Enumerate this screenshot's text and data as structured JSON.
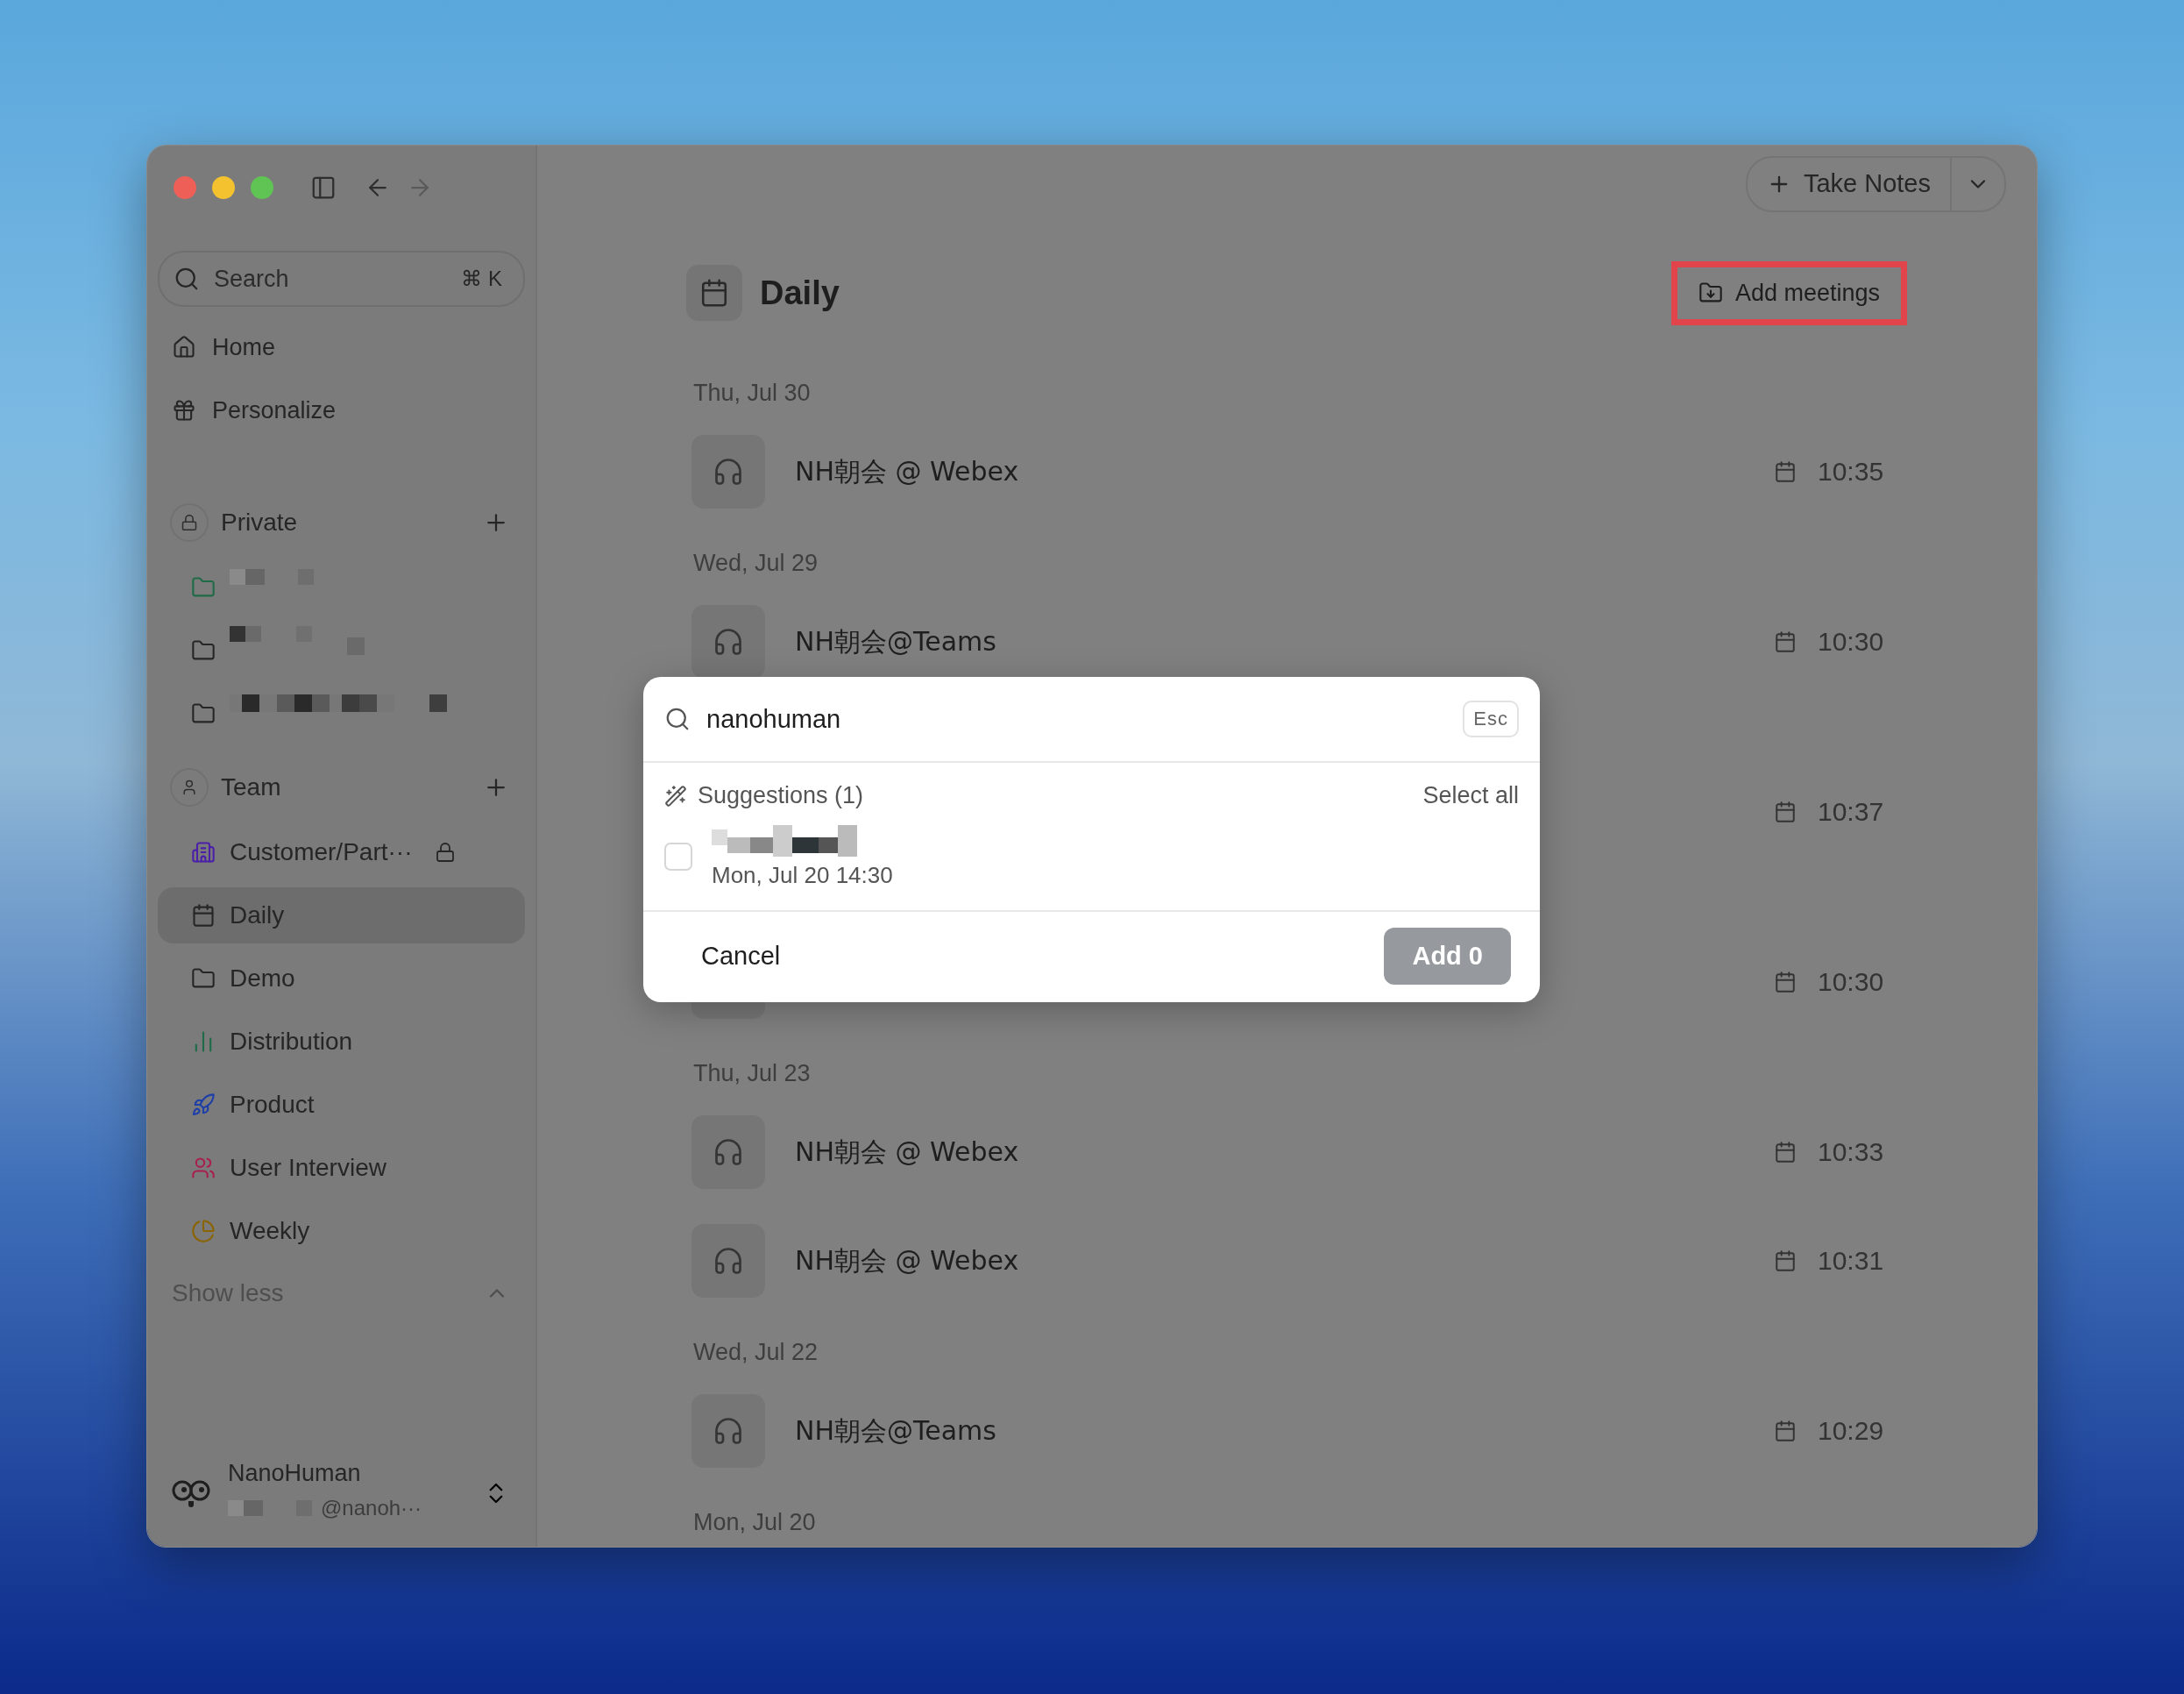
{
  "toolbar": {
    "take_notes": "Take Notes",
    "menu_caret": true
  },
  "sidebar": {
    "search": {
      "placeholder": "Search",
      "shortcut": "⌘ K"
    },
    "nav": [
      {
        "kind": "home",
        "label": "Home"
      },
      {
        "kind": "personalize",
        "label": "Personalize"
      }
    ],
    "sections": [
      {
        "kind": "private",
        "title": "Private",
        "items": [
          {
            "kind": "folder",
            "color": "#1f6b47"
          },
          {
            "kind": "folder",
            "color": "#262626"
          },
          {
            "kind": "folder",
            "color": "#262626"
          }
        ]
      },
      {
        "kind": "team",
        "title": "Team",
        "items": [
          {
            "kind": "building",
            "label": "Customer/Part···",
            "color": "#4b1fa8",
            "locked": true,
            "selected": false
          },
          {
            "kind": "calendar",
            "label": "Daily",
            "color": "#262626",
            "locked": false,
            "selected": true
          },
          {
            "kind": "folder",
            "label": "Demo",
            "color": "#262626",
            "locked": false,
            "selected": false
          },
          {
            "kind": "chart",
            "label": "Distribution",
            "color": "#1f6b47",
            "locked": false,
            "selected": false
          },
          {
            "kind": "rocket",
            "label": "Product",
            "color": "#1f3fa8",
            "locked": false,
            "selected": false
          },
          {
            "kind": "users",
            "label": "User Interview",
            "color": "#a81f4f",
            "locked": false,
            "selected": false
          },
          {
            "kind": "pie",
            "label": "Weekly",
            "color": "#8a6400",
            "locked": false,
            "selected": false
          }
        ]
      }
    ],
    "show_less": "Show less",
    "user": {
      "name": "NanoHuman",
      "handle": "@nanoh···"
    }
  },
  "page": {
    "title": "Daily",
    "add_meetings": {
      "label": "Add meetings",
      "highlighted": true
    },
    "groups": [
      {
        "date": "Thu, Jul 30",
        "meetings": [
          {
            "title": "NH朝会 @ Webex",
            "time": "10:35"
          }
        ]
      },
      {
        "date": "Wed, Jul 29",
        "meetings": [
          {
            "title": "NH朝会@Teams",
            "time": "10:30"
          }
        ]
      },
      {
        "meetings": [
          {
            "time": "10:37"
          }
        ]
      },
      {
        "meetings": [
          {
            "time": "10:30"
          }
        ]
      },
      {
        "date": "Thu, Jul 23",
        "meetings": [
          {
            "title": "NH朝会 @ Webex",
            "time": "10:33"
          },
          {
            "title": "NH朝会 @ Webex",
            "time": "10:31"
          }
        ]
      },
      {
        "date": "Wed, Jul 22",
        "meetings": [
          {
            "title": "NH朝会@Teams",
            "time": "10:29"
          }
        ]
      },
      {
        "date": "Mon, Jul 20"
      }
    ]
  },
  "dialog": {
    "search_value": "nanohuman",
    "esc": "Esc",
    "suggestions_title": "Suggestions (1)",
    "select_all": "Select all",
    "suggestions": [
      {
        "subtitle": "Mon, Jul 20 14:30",
        "checked": false
      }
    ],
    "cancel": "Cancel",
    "add": {
      "label": "Add 0",
      "disabled": true
    }
  }
}
